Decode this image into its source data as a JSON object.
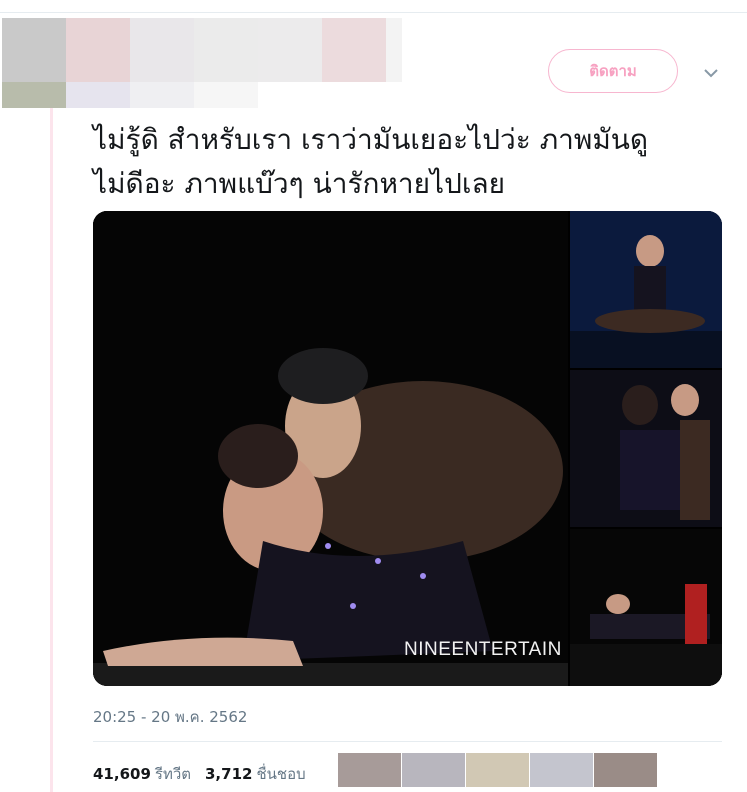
{
  "header": {
    "follow_label": "ติดตาม"
  },
  "tweet": {
    "text": "ไม่รู้ดิ สำหรับเรา เราว่ามันเยอะไปว่ะ ภาพมันดู\nไม่ดีอะ ภาพแบ๊วๆ น่ารักหายไปเลย",
    "watermark": "NINEENTERTAIN",
    "timestamp": "20:25 - 20 พ.ค. 2562"
  },
  "stats": {
    "retweets_count": "41,609",
    "retweets_label": "รีทวีต",
    "likes_count": "3,712",
    "likes_label": "ชื่นชอบ"
  },
  "colors": {
    "accent_pink": "#f7a1c1",
    "thread_line": "#fce4ec",
    "muted_text": "#657786"
  }
}
